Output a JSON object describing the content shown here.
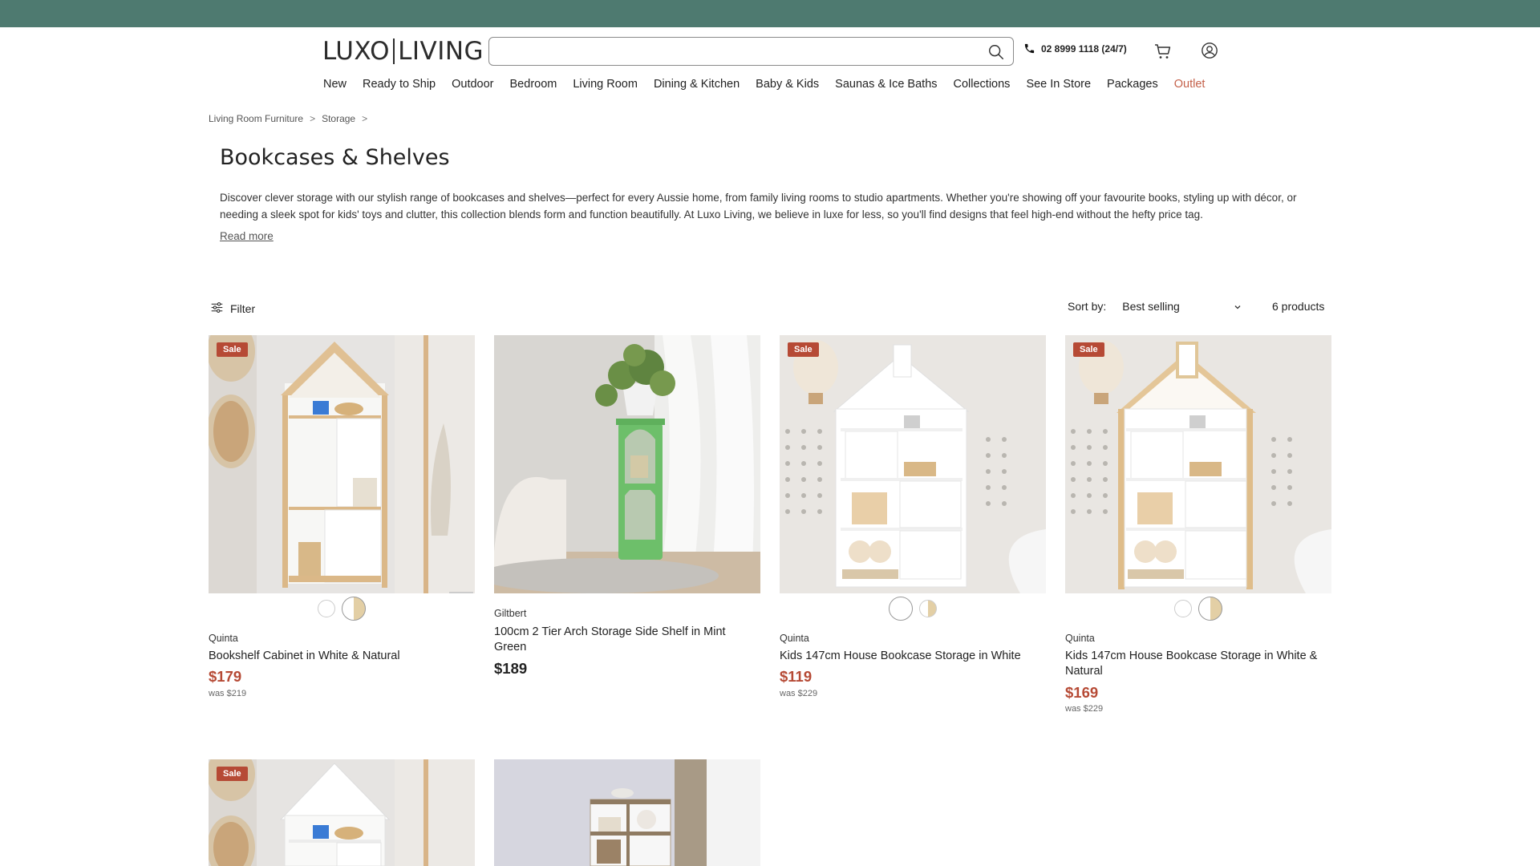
{
  "header": {
    "logo_left": "LUXO",
    "logo_right": "LIVING",
    "search": {
      "placeholder": "",
      "value": ""
    },
    "phone": "02 8999 1118  (24/7)",
    "icons": {
      "search": "search-icon",
      "phone": "phone-icon",
      "cart": "cart-icon",
      "account": "account-icon"
    }
  },
  "nav": {
    "items": [
      {
        "label": "New"
      },
      {
        "label": "Ready to Ship"
      },
      {
        "label": "Outdoor"
      },
      {
        "label": "Bedroom"
      },
      {
        "label": "Living Room"
      },
      {
        "label": "Dining & Kitchen"
      },
      {
        "label": "Baby & Kids"
      },
      {
        "label": "Saunas & Ice Baths"
      },
      {
        "label": "Collections"
      },
      {
        "label": "See In Store"
      },
      {
        "label": "Packages"
      },
      {
        "label": "Outlet"
      }
    ]
  },
  "breadcrumb": {
    "items": [
      "Living Room Furniture",
      "Storage"
    ],
    "separator": ">"
  },
  "collection": {
    "title": "Bookcases & Shelves",
    "description": "Discover clever storage with our stylish range of bookcases and shelves—perfect for every Aussie home, from family living rooms to studio apartments. Whether you're showing off your favourite books, styling up with décor, or needing a sleek spot for kids' toys and clutter, this collection blends form and function beautifully. At Luxo Living, we believe in luxe for less, so you'll find designs that feel high-end without the hefty price tag.",
    "read_more": "Read more"
  },
  "toolbar": {
    "filter_label": "Filter",
    "sort_label": "Sort by:",
    "sort_value": "Best selling",
    "count": "6 products"
  },
  "colors": {
    "topbar": "#4e7a70",
    "sale": "#b64a35",
    "outlet": "#c4614a"
  },
  "products": [
    {
      "badge": "Sale",
      "brand": "Quinta",
      "name": "Bookshelf Cabinet in White & Natural",
      "price": "$179",
      "was": "was $219",
      "swatches": [
        "white",
        "white-natural"
      ],
      "selected_swatch": 1
    },
    {
      "badge": "",
      "brand": "Giltbert",
      "name": "100cm 2 Tier Arch Storage Side Shelf in Mint Green",
      "price": "$189",
      "was": "",
      "swatches": [],
      "selected_swatch": -1
    },
    {
      "badge": "Sale",
      "brand": "Quinta",
      "name": "Kids 147cm House Bookcase Storage in White",
      "price": "$119",
      "was": "was $229",
      "swatches": [
        "white",
        "white-natural"
      ],
      "selected_swatch": 0
    },
    {
      "badge": "Sale",
      "brand": "Quinta",
      "name": "Kids 147cm House Bookcase Storage in White & Natural",
      "price": "$169",
      "was": "was $229",
      "swatches": [
        "white",
        "white-natural"
      ],
      "selected_swatch": 1
    },
    {
      "badge": "Sale",
      "brand": "",
      "name": "",
      "price": "",
      "was": "",
      "swatches": [],
      "selected_swatch": -1
    },
    {
      "badge": "",
      "brand": "",
      "name": "",
      "price": "",
      "was": "",
      "swatches": [],
      "selected_swatch": -1
    }
  ]
}
